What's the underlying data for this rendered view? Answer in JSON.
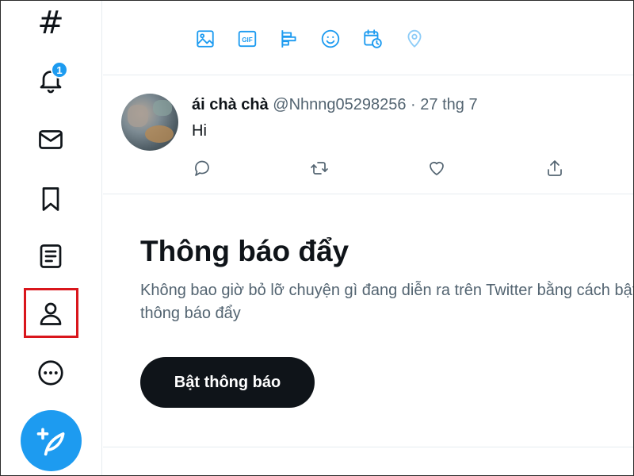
{
  "sidebar": {
    "explore_glyph": "#",
    "notifications_badge": "1",
    "icons": [
      "hashtag-icon",
      "bell-icon",
      "mail-icon",
      "bookmark-icon",
      "list-icon",
      "profile-icon",
      "more-icon",
      "compose-feather-icon"
    ]
  },
  "composer_toolbar": {
    "icons": [
      "image-icon",
      "gif-icon",
      "poll-icon",
      "emoji-icon",
      "schedule-icon",
      "location-icon"
    ],
    "gif_label": "GIF"
  },
  "tweet": {
    "name": "ái chà chà",
    "meta": "@Nhnng05298256 · 27 thg 7",
    "text": "Hi",
    "actions": [
      "reply-icon",
      "retweet-icon",
      "like-icon",
      "share-icon"
    ]
  },
  "push": {
    "title": "Thông báo đẩy",
    "description": "Không bao giờ bỏ lỡ chuyện gì đang diễn ra trên Twitter bằng cách bật thông báo đẩy",
    "button_label": "Bật thông báo"
  },
  "colors": {
    "accent": "#1d9bf0",
    "highlight": "#d9161c",
    "text": "#0f1419",
    "muted": "#536471"
  }
}
